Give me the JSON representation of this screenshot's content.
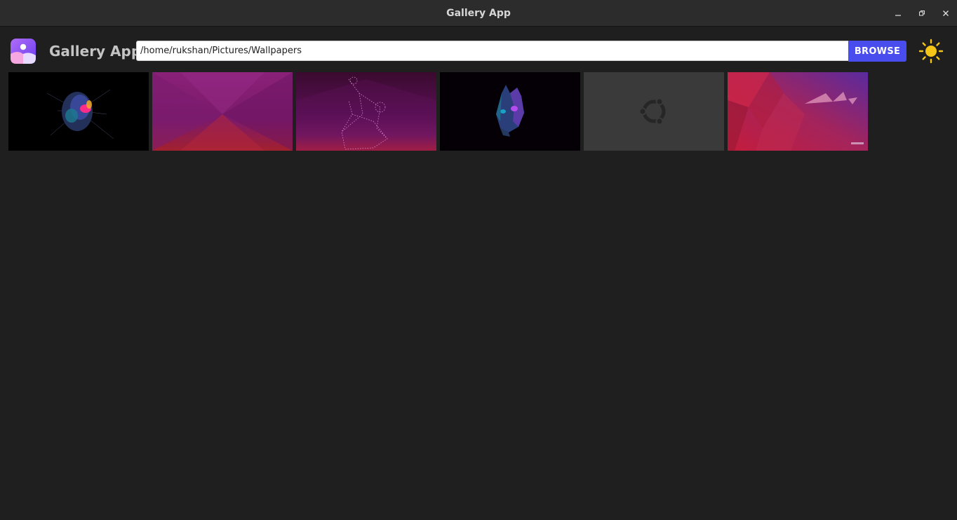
{
  "window": {
    "title": "Gallery App"
  },
  "header": {
    "app_name": "Gallery App",
    "path_value": "/home/rukshan/Pictures/Wallpapers",
    "browse_label": "BROWSE",
    "theme_icon": "sun-icon",
    "logo_icon": "gallery-logo-icon"
  },
  "colors": {
    "background": "#1f1f1f",
    "titlebar": "#2c2c2c",
    "accent": "#4a4ded",
    "sun": "#f5c518"
  },
  "gallery": {
    "thumbnails": [
      {
        "name": "thumbnail-1",
        "subject": "spiderman-mask-dark"
      },
      {
        "name": "thumbnail-2",
        "subject": "purple-geometric"
      },
      {
        "name": "thumbnail-3",
        "subject": "purple-dotted-figure"
      },
      {
        "name": "thumbnail-4",
        "subject": "cat-face-dark"
      },
      {
        "name": "thumbnail-5",
        "subject": "ubuntu-gray-logo"
      },
      {
        "name": "thumbnail-6",
        "subject": "red-purple-polygons"
      }
    ]
  }
}
